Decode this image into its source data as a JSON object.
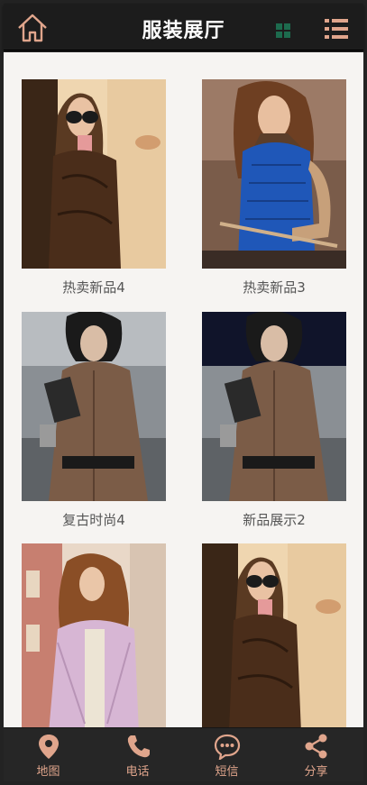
{
  "header": {
    "title": "服装展厅",
    "home_icon": "home-outline-icon",
    "grid_icon": "grid-view-icon",
    "list_icon": "list-view-icon"
  },
  "products": [
    {
      "name": "热卖新品4",
      "image": "woman-fur-coat-sunglasses"
    },
    {
      "name": "热卖新品3",
      "image": "woman-blue-puffer-vest"
    },
    {
      "name": "复古时尚4",
      "image": "woman-brown-trench-coat"
    },
    {
      "name": "新品展示2",
      "image": "woman-brown-trench-coat"
    },
    {
      "name": "",
      "image": "woman-pink-coat-curly-hair"
    },
    {
      "name": "",
      "image": "woman-fur-coat-sunglasses"
    }
  ],
  "footer": {
    "tabs": [
      {
        "label": "地图",
        "icon": "map-pin-icon"
      },
      {
        "label": "电话",
        "icon": "phone-icon"
      },
      {
        "label": "短信",
        "icon": "message-icon"
      },
      {
        "label": "分享",
        "icon": "share-icon"
      }
    ]
  },
  "colors": {
    "accent": "#e0a58c",
    "header_bg": "#1c1c1c",
    "content_bg": "#f6f4f2",
    "grid_icon": "#1d6b4e"
  }
}
